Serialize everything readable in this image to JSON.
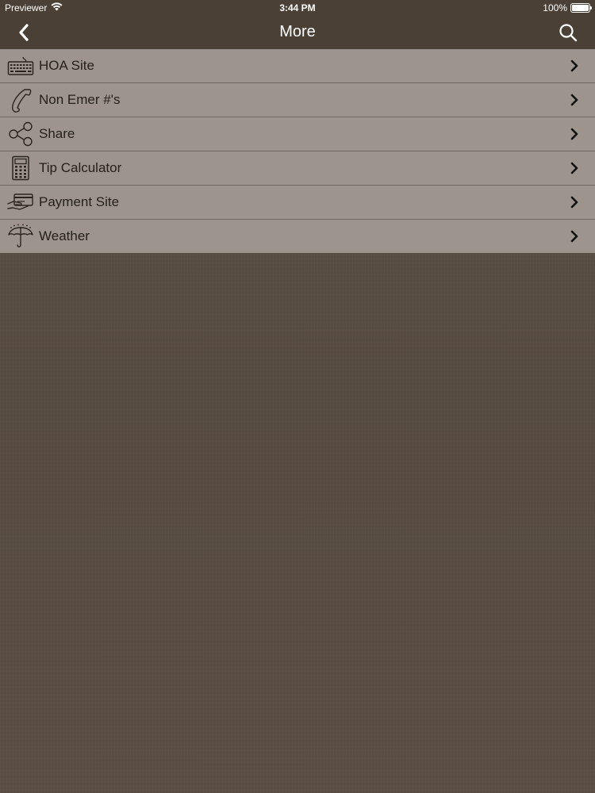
{
  "status_bar": {
    "carrier": "Previewer",
    "time": "3:44 PM",
    "battery_percent": "100%",
    "battery_level": 1.0,
    "wifi_icon": "wifi-icon"
  },
  "nav": {
    "title": "More",
    "back_icon": "chevron-left-icon",
    "search_icon": "search-icon"
  },
  "menu": {
    "items": [
      {
        "label": "HOA Site",
        "icon": "keyboard-icon"
      },
      {
        "label": "Non Emer #'s",
        "icon": "phone-icon"
      },
      {
        "label": "Share",
        "icon": "share-icon"
      },
      {
        "label": "Tip Calculator",
        "icon": "calculator-icon"
      },
      {
        "label": "Payment Site",
        "icon": "credit-card-icon"
      },
      {
        "label": "Weather",
        "icon": "umbrella-icon"
      }
    ]
  },
  "colors": {
    "header_bg": "#4a4036",
    "list_bg": "#9d958d",
    "list_text": "#252019",
    "page_bg": "#564b40"
  }
}
